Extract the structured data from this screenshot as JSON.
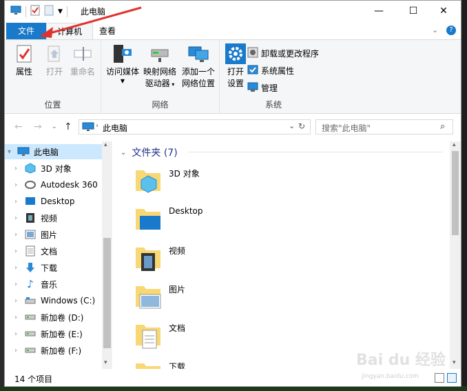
{
  "window": {
    "title": "此电脑",
    "controls": {
      "minimize": "—",
      "maximize": "☐",
      "close": "✕"
    }
  },
  "ribbon_tabs": [
    {
      "label": "文件"
    },
    {
      "label": "计算机"
    },
    {
      "label": "查看"
    }
  ],
  "ribbon": {
    "groups": {
      "location": {
        "label": "位置",
        "buttons": [
          "属性",
          "打开",
          "重命名"
        ]
      },
      "network": {
        "label": "网络",
        "buttons": [
          "访问媒体",
          "映射网络",
          "驱动器",
          "添加一个",
          "网络位置"
        ]
      },
      "system": {
        "label": "系统",
        "open_settings": [
          "打开",
          "设置"
        ],
        "small_buttons": [
          "卸载或更改程序",
          "系统属性",
          "管理"
        ]
      }
    }
  },
  "address": {
    "path": "此电脑",
    "search_placeholder": "搜索\"此电脑\""
  },
  "nav_pane": {
    "items": [
      {
        "label": "此电脑",
        "icon": "pc-icon",
        "selected": true
      },
      {
        "label": "3D 对象",
        "icon": "3d-objects-icon"
      },
      {
        "label": "Autodesk 360",
        "icon": "autodesk-icon"
      },
      {
        "label": "Desktop",
        "icon": "desktop-icon"
      },
      {
        "label": "视频",
        "icon": "video-icon"
      },
      {
        "label": "图片",
        "icon": "pictures-icon"
      },
      {
        "label": "文档",
        "icon": "documents-icon"
      },
      {
        "label": "下载",
        "icon": "downloads-icon"
      },
      {
        "label": "音乐",
        "icon": "music-icon"
      },
      {
        "label": "Windows (C:)",
        "icon": "drive-c-icon"
      },
      {
        "label": "新加卷 (D:)",
        "icon": "drive-icon"
      },
      {
        "label": "新加卷 (E:)",
        "icon": "drive-icon"
      },
      {
        "label": "新加卷 (F:)",
        "icon": "drive-icon"
      }
    ]
  },
  "content": {
    "group_header": "文件夹 (7)",
    "folders": [
      {
        "label": "3D 对象",
        "icon": "3d-objects-folder-icon"
      },
      {
        "label": "Desktop",
        "icon": "desktop-folder-icon"
      },
      {
        "label": "视频",
        "icon": "video-folder-icon"
      },
      {
        "label": "图片",
        "icon": "pictures-folder-icon"
      },
      {
        "label": "文档",
        "icon": "documents-folder-icon"
      },
      {
        "label": "下载",
        "icon": "downloads-folder-icon"
      }
    ]
  },
  "status": {
    "item_count": "14 个项目"
  },
  "watermark": {
    "text": "Bai du 经验",
    "sub": "jingyan.baidu.com"
  },
  "colors": {
    "accent": "#1979ca",
    "folder": "#f8d775",
    "selected": "#cce8ff",
    "arrow": "#e0322e"
  }
}
